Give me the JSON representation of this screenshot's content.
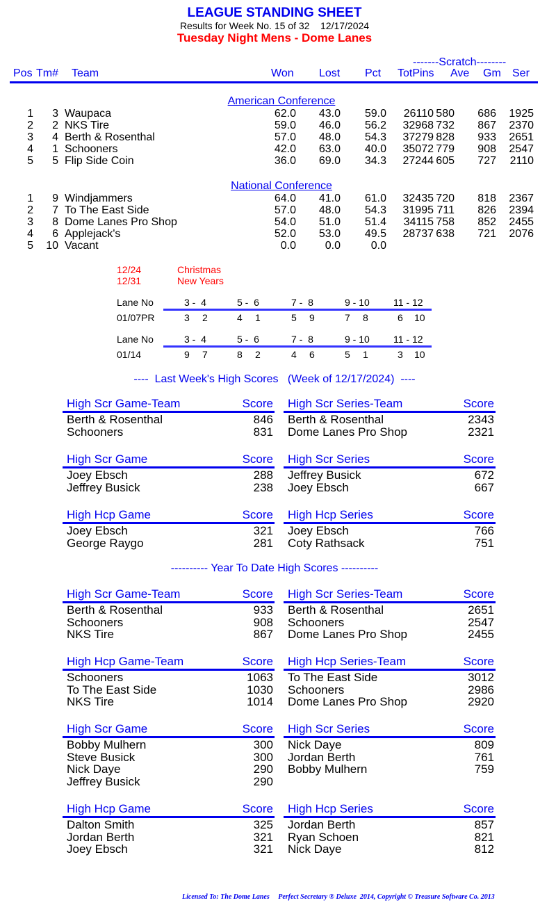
{
  "header": {
    "title": "LEAGUE STANDING SHEET",
    "subtitle": "Results for Week No. 15 of 32    12/17/2024",
    "league": "Tuesday Night Mens - Dome Lanes"
  },
  "columns": {
    "scratch_label": "-------Scratch--------",
    "pos": "Pos",
    "tm": "Tm#",
    "team": "Team",
    "won": "Won",
    "lost": "Lost",
    "pct": "Pct",
    "totpins": "TotPins",
    "ave": "Ave",
    "gm": "Gm",
    "ser": "Ser"
  },
  "conferences": [
    {
      "name": "American Conference",
      "rows": [
        {
          "pos": "1",
          "tm": "3",
          "team": "Waupaca",
          "won": "62.0",
          "lost": "43.0",
          "pct": "59.0",
          "totpins": "26110",
          "ave": "580",
          "gm": "686",
          "ser": "1925"
        },
        {
          "pos": "2",
          "tm": "2",
          "team": "NKS Tire",
          "won": "59.0",
          "lost": "46.0",
          "pct": "56.2",
          "totpins": "32968",
          "ave": "732",
          "gm": "867",
          "ser": "2370"
        },
        {
          "pos": "3",
          "tm": "4",
          "team": "Berth & Rosenthal",
          "won": "57.0",
          "lost": "48.0",
          "pct": "54.3",
          "totpins": "37279",
          "ave": "828",
          "gm": "933",
          "ser": "2651"
        },
        {
          "pos": "4",
          "tm": "1",
          "team": "Schooners",
          "won": "42.0",
          "lost": "63.0",
          "pct": "40.0",
          "totpins": "35072",
          "ave": "779",
          "gm": "908",
          "ser": "2547"
        },
        {
          "pos": "5",
          "tm": "5",
          "team": "Flip Side Coin",
          "won": "36.0",
          "lost": "69.0",
          "pct": "34.3",
          "totpins": "27244",
          "ave": "605",
          "gm": "727",
          "ser": "2110"
        }
      ]
    },
    {
      "name": "National Conference",
      "rows": [
        {
          "pos": "1",
          "tm": "9",
          "team": "Windjammers",
          "won": "64.0",
          "lost": "41.0",
          "pct": "61.0",
          "totpins": "32435",
          "ave": "720",
          "gm": "818",
          "ser": "2367"
        },
        {
          "pos": "2",
          "tm": "7",
          "team": "To The East Side",
          "won": "57.0",
          "lost": "48.0",
          "pct": "54.3",
          "totpins": "31995",
          "ave": "711",
          "gm": "826",
          "ser": "2394"
        },
        {
          "pos": "3",
          "tm": "8",
          "team": "Dome Lanes Pro Shop",
          "won": "54.0",
          "lost": "51.0",
          "pct": "51.4",
          "totpins": "34115",
          "ave": "758",
          "gm": "852",
          "ser": "2455"
        },
        {
          "pos": "4",
          "tm": "6",
          "team": "Applejack's",
          "won": "52.0",
          "lost": "53.0",
          "pct": "49.5",
          "totpins": "28737",
          "ave": "638",
          "gm": "721",
          "ser": "2076"
        },
        {
          "pos": "5",
          "tm": "10",
          "team": "Vacant",
          "won": "0.0",
          "lost": "0.0",
          "pct": "0.0",
          "totpins": "",
          "ave": "",
          "gm": "",
          "ser": ""
        }
      ]
    }
  ],
  "holidays": [
    {
      "date": "12/24",
      "name": "Christmas"
    },
    {
      "date": "12/31",
      "name": "New Years"
    }
  ],
  "lane_schedule": [
    {
      "lane_label": "Lane No",
      "lanes": [
        "3 -  4",
        "5 -  6",
        "7 -  8",
        "9 - 10",
        "11 - 12"
      ],
      "date": "01/07PR",
      "pairs": [
        [
          "3",
          "2"
        ],
        [
          "4",
          "1"
        ],
        [
          "5",
          "9"
        ],
        [
          "7",
          "8"
        ],
        [
          "6",
          "10"
        ]
      ]
    },
    {
      "lane_label": "Lane No",
      "lanes": [
        "3 -  4",
        "5 -  6",
        "7 -  8",
        "9 - 10",
        "11 - 12"
      ],
      "date": "01/14",
      "pairs": [
        [
          "9",
          "7"
        ],
        [
          "8",
          "2"
        ],
        [
          "4",
          "6"
        ],
        [
          "5",
          "1"
        ],
        [
          "3",
          "10"
        ]
      ]
    }
  ],
  "last_week": {
    "title": "----  Last Week's High Scores   (Week of 12/17/2024)  ----",
    "boxes": [
      {
        "label": "High Scr Game-Team",
        "score_label": "Score",
        "rows": [
          {
            "name": "Berth & Rosenthal",
            "score": "846"
          },
          {
            "name": "Schooners",
            "score": "831"
          }
        ]
      },
      {
        "label": "High Scr Series-Team",
        "score_label": "Score",
        "rows": [
          {
            "name": "Berth & Rosenthal",
            "score": "2343"
          },
          {
            "name": "Dome Lanes Pro Shop",
            "score": "2321"
          }
        ]
      },
      {
        "label": "High Scr Game",
        "score_label": "Score",
        "rows": [
          {
            "name": "Joey Ebsch",
            "score": "288"
          },
          {
            "name": "Jeffrey Busick",
            "score": "238"
          }
        ]
      },
      {
        "label": "High Scr Series",
        "score_label": "Score",
        "rows": [
          {
            "name": "Jeffrey Busick",
            "score": "672"
          },
          {
            "name": "Joey Ebsch",
            "score": "667"
          }
        ]
      },
      {
        "label": "High Hcp Game",
        "score_label": "Score",
        "rows": [
          {
            "name": "Joey Ebsch",
            "score": "321"
          },
          {
            "name": "George Raygo",
            "score": "281"
          }
        ]
      },
      {
        "label": "High Hcp Series",
        "score_label": "Score",
        "rows": [
          {
            "name": "Joey Ebsch",
            "score": "766"
          },
          {
            "name": "Coty Rathsack",
            "score": "751"
          }
        ]
      }
    ]
  },
  "ytd": {
    "title": "---------- Year To Date High Scores ----------",
    "boxes": [
      {
        "label": "High Scr Game-Team",
        "score_label": "Score",
        "rows": [
          {
            "name": "Berth & Rosenthal",
            "score": "933"
          },
          {
            "name": "Schooners",
            "score": "908"
          },
          {
            "name": "NKS Tire",
            "score": "867"
          }
        ]
      },
      {
        "label": "High Scr Series-Team",
        "score_label": "Score",
        "rows": [
          {
            "name": "Berth & Rosenthal",
            "score": "2651"
          },
          {
            "name": "Schooners",
            "score": "2547"
          },
          {
            "name": "Dome Lanes Pro Shop",
            "score": "2455"
          }
        ]
      },
      {
        "label": "High Hcp Game-Team",
        "score_label": "Score",
        "rows": [
          {
            "name": "Schooners",
            "score": "1063"
          },
          {
            "name": "To The East Side",
            "score": "1030"
          },
          {
            "name": "NKS Tire",
            "score": "1014"
          }
        ]
      },
      {
        "label": "High Hcp Series-Team",
        "score_label": "Score",
        "rows": [
          {
            "name": "To The East Side",
            "score": "3012"
          },
          {
            "name": "Schooners",
            "score": "2986"
          },
          {
            "name": "Dome Lanes Pro Shop",
            "score": "2920"
          }
        ]
      },
      {
        "label": "High Scr Game",
        "score_label": "Score",
        "rows": [
          {
            "name": "Bobby Mulhern",
            "score": "300"
          },
          {
            "name": "Steve Busick",
            "score": "300"
          },
          {
            "name": "Nick Daye",
            "score": "290"
          },
          {
            "name": "Jeffrey Busick",
            "score": "290"
          }
        ]
      },
      {
        "label": "High Scr Series",
        "score_label": "Score",
        "rows": [
          {
            "name": "Nick Daye",
            "score": "809"
          },
          {
            "name": "Jordan Berth",
            "score": "761"
          },
          {
            "name": "Bobby Mulhern",
            "score": "759"
          }
        ]
      },
      {
        "label": "High Hcp Game",
        "score_label": "Score",
        "rows": [
          {
            "name": "Dalton Smith",
            "score": "325"
          },
          {
            "name": "Jordan Berth",
            "score": "321"
          },
          {
            "name": "Joey Ebsch",
            "score": "321"
          }
        ]
      },
      {
        "label": "High Hcp Series",
        "score_label": "Score",
        "rows": [
          {
            "name": "Jordan Berth",
            "score": "857"
          },
          {
            "name": "Ryan Schoen",
            "score": "821"
          },
          {
            "name": "Nick Daye",
            "score": "812"
          }
        ]
      }
    ]
  },
  "footer": {
    "text": "Licensed To: The Dome Lanes     Perfect Secretary ® Deluxe  2014, Copyright © Treasure Software Co. 2013"
  }
}
